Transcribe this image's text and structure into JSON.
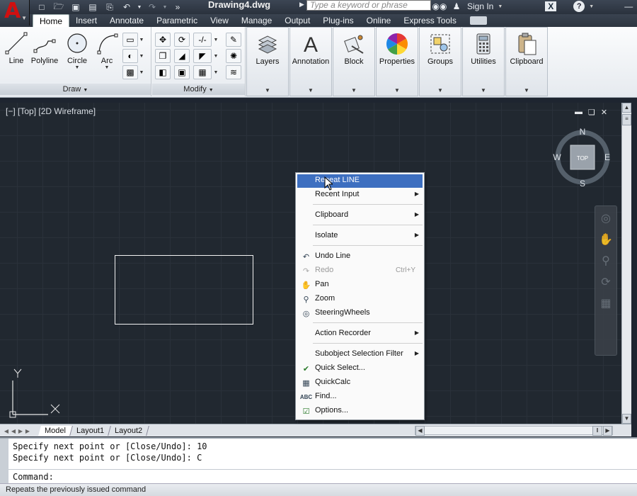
{
  "window": {
    "doc_title": "Drawing4.dwg"
  },
  "search": {
    "placeholder": "Type a keyword or phrase"
  },
  "account": {
    "sign_in": "Sign In"
  },
  "help": {
    "label": "?"
  },
  "xchange": {
    "label": "X"
  },
  "app_button": {
    "letter": "A"
  },
  "ribbon": {
    "tabs": [
      "Home",
      "Insert",
      "Annotate",
      "Parametric",
      "View",
      "Manage",
      "Output",
      "Plug-ins",
      "Online",
      "Express Tools"
    ],
    "active_tab": "Home",
    "draw_panel": {
      "title": "Draw",
      "tools": [
        "Line",
        "Polyline",
        "Circle",
        "Arc"
      ]
    },
    "modify_panel": {
      "title": "Modify"
    },
    "groups": [
      "Layers",
      "Annotation",
      "Block",
      "Properties",
      "Groups",
      "Utilities",
      "Clipboard"
    ]
  },
  "viewport": {
    "label": "[−] [Top] [2D Wireframe]",
    "viewcube": {
      "face": "TOP",
      "n": "N",
      "s": "S",
      "e": "E",
      "w": "W"
    },
    "ucs": {
      "y": "Y",
      "x": "X"
    }
  },
  "layout_tabs": [
    "Model",
    "Layout1",
    "Layout2"
  ],
  "context_menu": {
    "items": [
      {
        "label": "Repeat LINE",
        "selected": true
      },
      {
        "label": "Recent Input",
        "submenu": true
      },
      {
        "label": "Clipboard",
        "submenu": true
      },
      {
        "label": "Isolate",
        "submenu": true
      },
      {
        "label": "Undo Line"
      },
      {
        "label": "Redo",
        "shortcut": "Ctrl+Y",
        "disabled": true
      },
      {
        "label": "Pan"
      },
      {
        "label": "Zoom"
      },
      {
        "label": "SteeringWheels"
      },
      {
        "label": "Action Recorder",
        "submenu": true
      },
      {
        "label": "Subobject Selection Filter",
        "submenu": true
      },
      {
        "label": "Quick Select..."
      },
      {
        "label": "QuickCalc"
      },
      {
        "label": "Find..."
      },
      {
        "label": "Options..."
      }
    ]
  },
  "command_line": {
    "history": [
      "Specify next point or [Close/Undo]: 10",
      "Specify next point or [Close/Undo]: C"
    ],
    "prompt": "Command:"
  },
  "status_bar": {
    "text": "Repeats the previously issued command"
  }
}
